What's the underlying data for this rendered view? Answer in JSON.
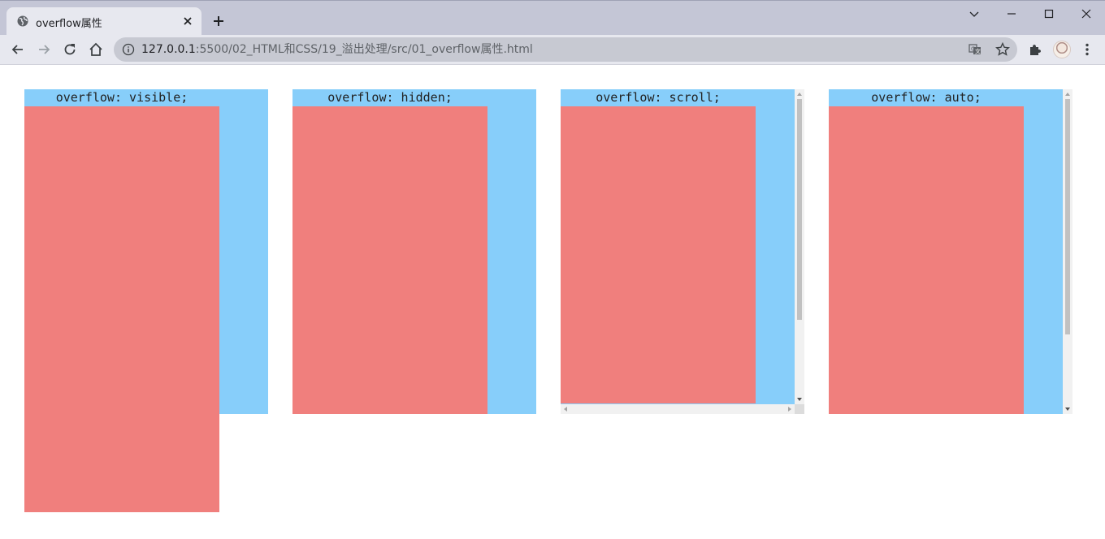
{
  "browser": {
    "tab": {
      "title": "overflow属性",
      "favicon": "globe-icon"
    },
    "new_tab_icon": "plus-icon",
    "window_controls": [
      "tab-search-chevron-icon",
      "minimize-icon",
      "maximize-icon",
      "close-icon"
    ],
    "address": {
      "url_host": "127.0.0.1",
      "url_rest": ":5500/02_HTML和CSS/19_溢出处理/src/01_overflow属性.html",
      "info_icon": "site-info-icon"
    },
    "toolbar_icons": [
      "back-arrow-icon",
      "forward-arrow-icon",
      "reload-icon",
      "home-icon",
      "translate-icon",
      "bookmark-star-icon",
      "extensions-puzzle-icon",
      "profile-avatar",
      "more-menu-icon"
    ]
  },
  "page": {
    "boxes": [
      {
        "label": "overflow: visible;",
        "overflow": "visible"
      },
      {
        "label": "overflow: hidden;",
        "overflow": "hidden"
      },
      {
        "label": "overflow: scroll;",
        "overflow": "scroll"
      },
      {
        "label": "overflow: auto;",
        "overflow": "auto"
      }
    ]
  },
  "colors": {
    "box_background": "#87cefa",
    "content_background": "#f07f7d",
    "tabbar": "#c4c6d6",
    "toolbar": "#e7e8ef",
    "omnibox": "#c7c9d2"
  }
}
